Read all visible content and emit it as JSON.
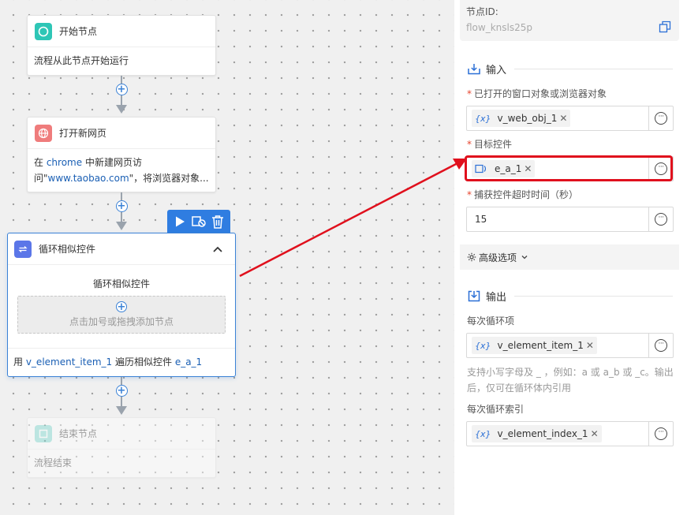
{
  "canvas": {
    "start_node": {
      "title": "开始节点",
      "desc": "流程从此节点开始运行"
    },
    "open_page_node": {
      "title": "打开新网页",
      "desc_prefix": "在 ",
      "desc_browser": "chrome",
      "desc_mid": " 中新建网页访",
      "desc_line2_prefix": "问\"",
      "desc_url": "www.taobao.com",
      "desc_suffix": "\"，将浏览器对象..."
    },
    "loop_node": {
      "title": "循环相似控件",
      "inner_title": "循环相似控件",
      "drop_hint": "点击加号或拖拽添加节点",
      "footer_prefix": "用 ",
      "footer_var": "v_element_item_1",
      "footer_mid": " 遍历相似控件 ",
      "footer_target": "e_a_1"
    },
    "end_node": {
      "title": "结束节点",
      "desc": "流程结束"
    }
  },
  "panel": {
    "node_id_label": "节点ID:",
    "node_id_value": "flow_knsls25p",
    "input_section": "输入",
    "fields": {
      "window_label": "已打开的窗口对象或浏览器对象",
      "window_value": "v_web_obj_1",
      "target_label": "目标控件",
      "target_value": "e_a_1",
      "timeout_label": "捕获控件超时时间（秒）",
      "timeout_value": "15"
    },
    "advanced_label": "高级选项",
    "output_section": "输出",
    "outputs": {
      "item_label": "每次循环项",
      "item_value": "v_element_item_1",
      "hint": "支持小写字母及 _ ，例如：a 或 a_b 或 _c。输出后，仅可在循环体内引用",
      "index_label": "每次循环索引",
      "index_value": "v_element_index_1"
    },
    "var_icon_text": "{x}",
    "required_mark": "*"
  },
  "colors": {
    "accent": "#3b82d6",
    "highlight": "#e0101d",
    "start_icon": "#2ec6b6",
    "web_icon": "#ef7c7c",
    "loop_icon": "#5b76e8"
  },
  "icons": [
    "start-circle-icon",
    "globe-icon",
    "loop-icon",
    "play-icon",
    "screen-icon",
    "trash-icon",
    "chevron-up-icon",
    "plus-icon",
    "copy-icon",
    "input-icon",
    "output-icon",
    "gear-icon",
    "chevron-down-icon",
    "element-icon",
    "close-icon",
    "more-icon"
  ]
}
